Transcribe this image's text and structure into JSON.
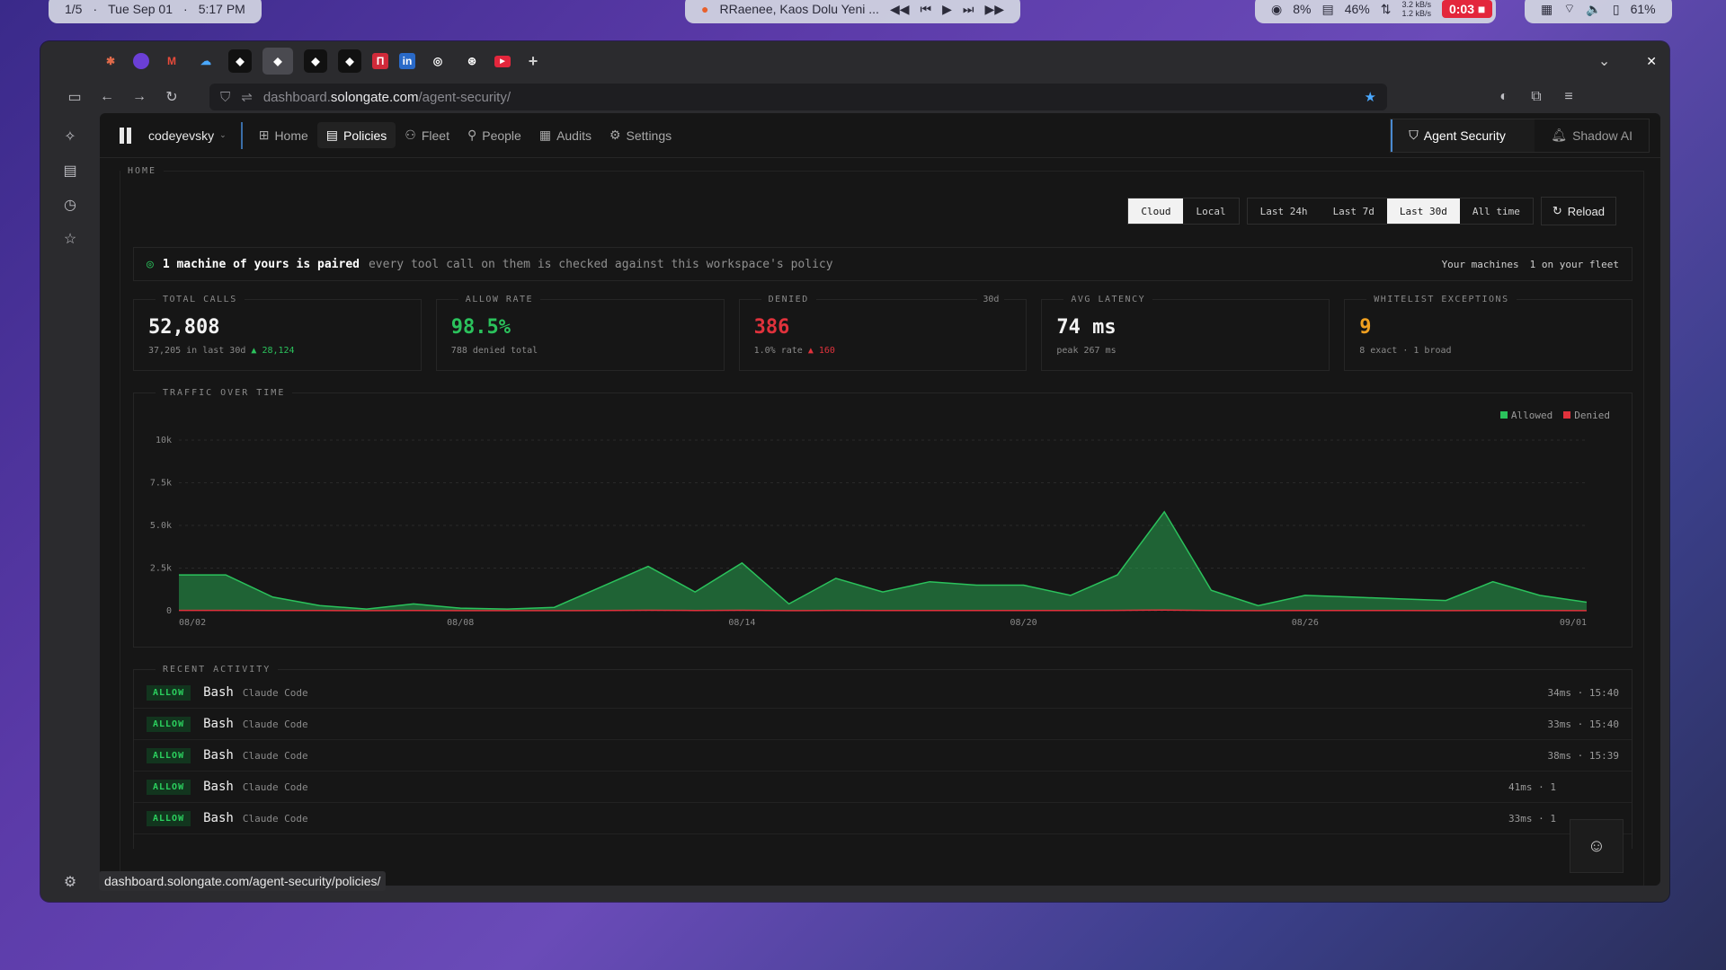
{
  "os": {
    "workspace": "1/5",
    "date": "Tue Sep 01",
    "time": "5:17 PM",
    "media_title": "RRaenee, Kaos Dolu Yeni ...",
    "cpu": "8%",
    "mem": "46%",
    "net_up": "3.2 kB/s",
    "net_down": "1.2 kB/s",
    "rec_time": "0:03",
    "battery": "61%"
  },
  "browser": {
    "url_prefix": "dashboard.",
    "url_host": "solongate.com",
    "url_path": "/agent-security/",
    "status_url": "dashboard.solongate.com/agent-security/policies/"
  },
  "nav": {
    "workspace": "codeyevsky",
    "items": [
      "Home",
      "Policies",
      "Fleet",
      "People",
      "Audits",
      "Settings"
    ],
    "agent_security": "Agent Security",
    "shadow_ai": "Shadow AI"
  },
  "home": {
    "section_label": "HOME",
    "source_options": [
      "Cloud",
      "Local"
    ],
    "source_selected": "Cloud",
    "range_options": [
      "Last 24h",
      "Last 7d",
      "Last 30d",
      "All time"
    ],
    "range_selected": "Last 30d",
    "reload": "Reload",
    "paired_title": "1 machine of yours is paired",
    "paired_desc": "every tool call on them is checked against this workspace's policy",
    "your_machines": "Your machines",
    "fleet_count": "1 on your fleet"
  },
  "kpis": {
    "total_calls": {
      "label": "TOTAL CALLS",
      "value": "52,808",
      "sub": "37,205 in last 30d",
      "delta": "▲ 28,124"
    },
    "allow_rate": {
      "label": "ALLOW RATE",
      "value": "98.5%",
      "sub": "788 denied total"
    },
    "denied": {
      "label": "DENIED",
      "period": "30d",
      "value": "386",
      "sub": "1.0% rate",
      "delta": "▲ 160"
    },
    "avg_latency": {
      "label": "AVG LATENCY",
      "value": "74 ms",
      "sub": "peak 267 ms"
    },
    "whitelist": {
      "label": "WHITELIST EXCEPTIONS",
      "value": "9",
      "sub": "8 exact · 1 broad"
    }
  },
  "colors": {
    "allowed": "#2bc25c",
    "denied": "#e0323c",
    "value_green": "#2bc25c",
    "value_red": "#e0323c",
    "value_orange": "#f0a020"
  },
  "chart_data": {
    "type": "area",
    "title": "TRAFFIC OVER TIME",
    "x_ticks": [
      "08/02",
      "08/08",
      "08/14",
      "08/20",
      "08/26",
      "09/01"
    ],
    "y_ticks": [
      "0",
      "2.5k",
      "5.0k",
      "7.5k",
      "10k"
    ],
    "ylim": [
      0,
      10000
    ],
    "legend": "top-right",
    "x": [
      "08/02",
      "08/03",
      "08/04",
      "08/05",
      "08/06",
      "08/07",
      "08/08",
      "08/09",
      "08/10",
      "08/11",
      "08/12",
      "08/13",
      "08/14",
      "08/15",
      "08/16",
      "08/17",
      "08/18",
      "08/19",
      "08/20",
      "08/21",
      "08/22",
      "08/23",
      "08/24",
      "08/25",
      "08/26",
      "08/27",
      "08/28",
      "08/29",
      "08/30",
      "08/31",
      "09/01"
    ],
    "series": [
      {
        "name": "Allowed",
        "values": [
          2100,
          2100,
          800,
          300,
          100,
          400,
          150,
          100,
          200,
          1400,
          2600,
          1100,
          2800,
          400,
          1900,
          1100,
          1700,
          1500,
          1500,
          900,
          2100,
          5800,
          1200,
          300,
          900,
          800,
          700,
          600,
          1700,
          900,
          500
        ]
      },
      {
        "name": "Denied",
        "values": [
          20,
          20,
          10,
          10,
          5,
          10,
          5,
          5,
          5,
          15,
          25,
          15,
          25,
          5,
          20,
          10,
          15,
          15,
          15,
          10,
          20,
          40,
          10,
          5,
          10,
          10,
          10,
          5,
          15,
          10,
          5
        ]
      }
    ]
  },
  "activity": {
    "label": "RECENT ACTIVITY",
    "rows": [
      {
        "decision": "ALLOW",
        "tool": "Bash",
        "agent": "Claude Code",
        "meta": "34ms · 15:40"
      },
      {
        "decision": "ALLOW",
        "tool": "Bash",
        "agent": "Claude Code",
        "meta": "33ms · 15:40"
      },
      {
        "decision": "ALLOW",
        "tool": "Bash",
        "agent": "Claude Code",
        "meta": "38ms · 15:39"
      },
      {
        "decision": "ALLOW",
        "tool": "Bash",
        "agent": "Claude Code",
        "meta": "41ms · 1"
      },
      {
        "decision": "ALLOW",
        "tool": "Bash",
        "agent": "Claude Code",
        "meta": "33ms · 1"
      }
    ]
  }
}
